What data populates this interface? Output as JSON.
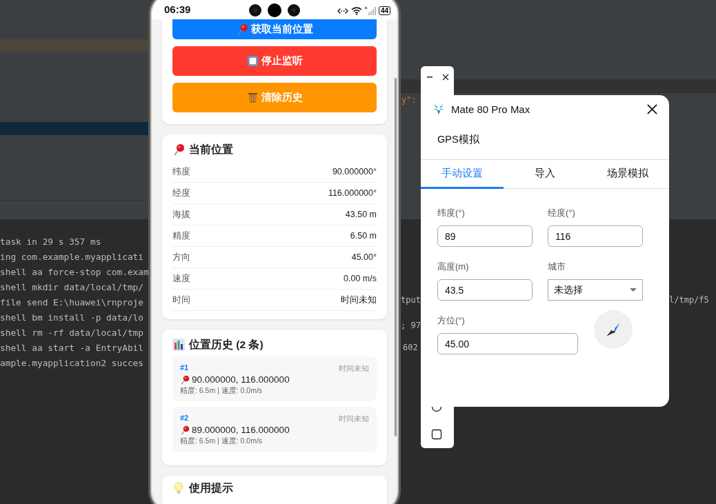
{
  "ide": {
    "console_lines": [
      "task in 29 s 357 ms",
      "ing com.example.myapplicati",
      "shell aa force-stop com.exam",
      "shell mkdir data/local/tmp/",
      "file send E:\\huawei\\rnproje",
      "shell bm install -p data/lo",
      "shell rm -rf data/local/tmp",
      "shell aa start -a EntryAbil",
      "ample.myapplication2 succes"
    ],
    "right_fragments": [
      {
        "kind": "code",
        "text": "y\":"
      },
      {
        "kind": "console",
        "text": "tput"
      },
      {
        "kind": "console",
        "text": "; 97"
      },
      {
        "kind": "console",
        "text": "602"
      },
      {
        "kind": "console_right",
        "text": "l/tmp/f5"
      }
    ]
  },
  "phone": {
    "status_time": "06:39",
    "battery": "44",
    "actions": [
      {
        "label": "获取当前位置",
        "kind": "primary"
      },
      {
        "label": "停止监听",
        "kind": "danger"
      },
      {
        "label": "清除历史",
        "kind": "warning"
      }
    ],
    "current_location": {
      "title": "当前位置",
      "rows": [
        {
          "label": "纬度",
          "value": "90.000000°"
        },
        {
          "label": "经度",
          "value": "116.000000°"
        },
        {
          "label": "海拔",
          "value": "43.50 m"
        },
        {
          "label": "精度",
          "value": "6.50 m"
        },
        {
          "label": "方向",
          "value": "45.00°"
        },
        {
          "label": "速度",
          "value": "0.00 m/s"
        },
        {
          "label": "时间",
          "value": "时间未知"
        }
      ]
    },
    "history": {
      "title": "位置历史 (2 条)",
      "items": [
        {
          "index": "#1",
          "time": "时间未知",
          "coords": "90.000000, 116.000000",
          "detail": "精度: 6.5m | 速度: 0.0m/s"
        },
        {
          "index": "#2",
          "time": "时间未知",
          "coords": "89.000000, 116.000000",
          "detail": "精度: 6.5m | 速度: 0.0m/s"
        }
      ]
    },
    "tips": {
      "title": "使用提示"
    }
  },
  "dialog": {
    "title": "Mate 80 Pro Max",
    "section": "GPS模拟",
    "tabs": [
      {
        "label": "手动设置",
        "selected": true
      },
      {
        "label": "导入",
        "selected": false
      },
      {
        "label": "场景模拟",
        "selected": false
      }
    ],
    "latitude": {
      "label": "纬度(°)",
      "value": "89"
    },
    "longitude": {
      "label": "经度(°)",
      "value": "116"
    },
    "altitude": {
      "label": "高度(m)",
      "value": "43.5"
    },
    "city": {
      "label": "城市",
      "value": "未选择"
    },
    "bearing": {
      "label": "方位(°)",
      "value": "45.00"
    }
  }
}
